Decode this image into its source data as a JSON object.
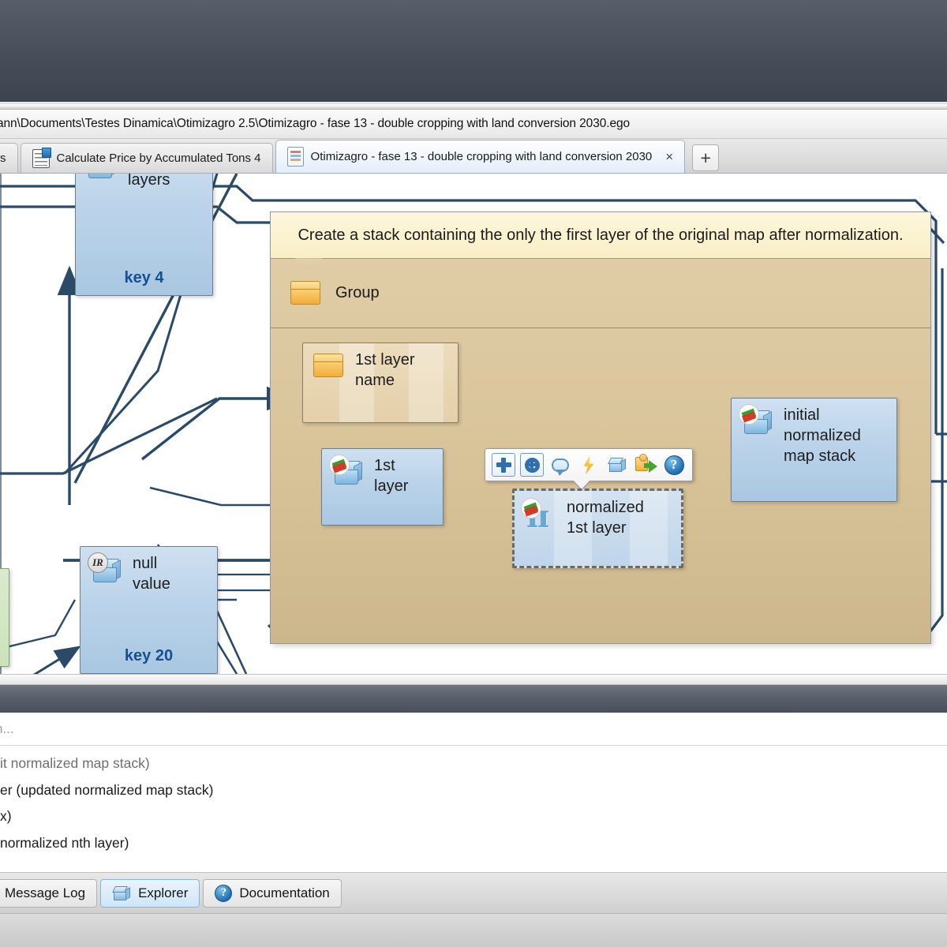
{
  "window": {
    "path_bar": "ann\\Documents\\Testes Dinamica\\Otimizagro 2.5\\Otimizagro - fase 13 - double cropping with land conversion 2030.ego"
  },
  "tabs": [
    {
      "label": "s",
      "icon": "document-icon",
      "active": false,
      "partial": true
    },
    {
      "label": "Calculate Price by Accumulated Tons 4",
      "icon": "calculator-icon",
      "active": false,
      "partial": false
    },
    {
      "label": "Otimizagro - fase 13 - double cropping with land conversion 2030",
      "icon": "model-document-icon",
      "active": true,
      "partial": false
    }
  ],
  "tab_controls": {
    "close": "×",
    "add": "+"
  },
  "group": {
    "comment": "Create a stack containing the only the first layer of the original map after normalization.",
    "header_label": "Group",
    "header_icon": "group-folder-icon"
  },
  "nodes": {
    "of_layers": {
      "label": "of\nlayers",
      "key": "key 4",
      "icon": "map-cube-icon"
    },
    "null_value": {
      "label": "null\nvalue",
      "key": "key 20",
      "icon": "real-number-cube-icon"
    },
    "first_layer_name": {
      "label": "1st layer\nname",
      "icon": "group-folder-icon"
    },
    "first_layer": {
      "label": "1st\nlayer",
      "icon": "map-cube-icon"
    },
    "normalized_first_layer": {
      "label": "normalized\n1st layer",
      "icon": "pi-calculator-icon",
      "selected": true
    },
    "initial_normalized_map_stack": {
      "label": "initial\nnormalized\nmap stack",
      "icon": "map-cube-icon"
    }
  },
  "float_toolbar": [
    {
      "name": "add-icon",
      "glyph": "plus"
    },
    {
      "name": "properties-gear-icon",
      "glyph": "gear"
    },
    {
      "name": "comment-bubble-icon",
      "glyph": "bubble"
    },
    {
      "name": "execute-lightning-icon",
      "glyph": "bolt"
    },
    {
      "name": "group-cube-icon",
      "glyph": "cube"
    },
    {
      "name": "plugin-puzzle-icon",
      "glyph": "puzzle"
    },
    {
      "name": "help-icon",
      "glyph": "help"
    }
  ],
  "bottom_panel": {
    "search_placeholder": "h...",
    "log_lines": [
      "it normalized map stack)",
      "er (updated normalized map stack)",
      "x)",
      "normalized nth layer)"
    ]
  },
  "bottom_tabs": [
    {
      "label": "Message Log",
      "icon": "log-icon",
      "active": false
    },
    {
      "label": "Explorer",
      "icon": "explorer-cube-icon",
      "active": true
    },
    {
      "label": "Documentation",
      "icon": "help-icon",
      "active": false
    }
  ],
  "colors": {
    "accent_blue": "#2f6fae",
    "group_tan": "#d9c49a",
    "comment_cream": "#f9eec6",
    "node_blue": "#bcd4ea",
    "key_text": "#17508f",
    "wire": "#2b4a68"
  }
}
